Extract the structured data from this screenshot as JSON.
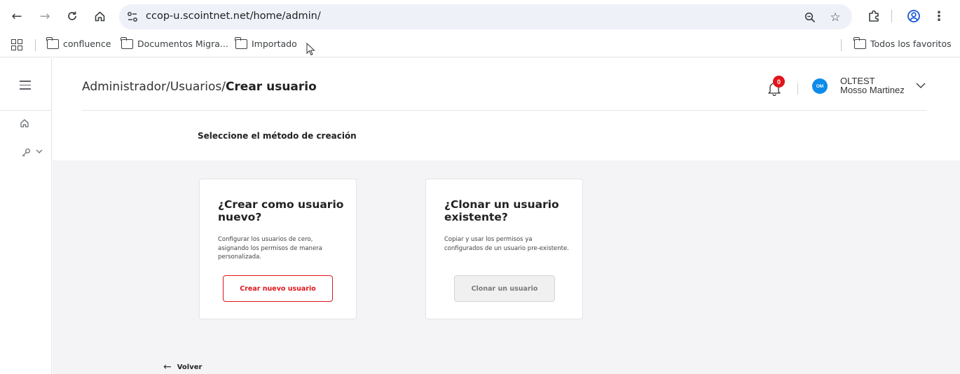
{
  "browser": {
    "url_domain": "ccop-u.scointnet.net",
    "url_path": "/home/admin/",
    "back_icon": "←",
    "forward_icon": "→",
    "reload_icon": "C",
    "home_icon": "⌂",
    "zoom_icon": "⚲",
    "star_icon": "☆",
    "more_icon": "⋮"
  },
  "bookmarks": {
    "items": [
      {
        "label": "confluence"
      },
      {
        "label": "Documentos Migra..."
      },
      {
        "label": "Importado"
      }
    ],
    "all_favorites": "Todos los favoritos"
  },
  "header": {
    "breadcrumb_path": "Administrador/Usuarios/",
    "breadcrumb_current": "Crear usuario",
    "notification_count": "0",
    "avatar_initials": "OM",
    "user_company": "OLTEST",
    "user_name": "Mosso Martinez"
  },
  "page": {
    "subtitle": "Seleccione el método de creación",
    "back_label": "Volver",
    "back_icon": "←"
  },
  "cards": [
    {
      "title": "¿Crear como usuario nuevo?",
      "description": "Configurar los usuarios de cero, asignando los permisos de manera personalizada.",
      "button": "Crear nuevo usuario"
    },
    {
      "title": "¿Clonar un usuario existente?",
      "description": "Copiar y usar los permisos ya configurados de un usuario pre-existente.",
      "button": "Clonar un usuario"
    }
  ],
  "sidebar": {
    "home_icon": "⌂",
    "key_icon": "⚷",
    "chevron": "∨"
  },
  "colors": {
    "accent_red": "#e1151c",
    "avatar_blue": "#0b8ce9",
    "content_bg": "#f4f4f6"
  }
}
